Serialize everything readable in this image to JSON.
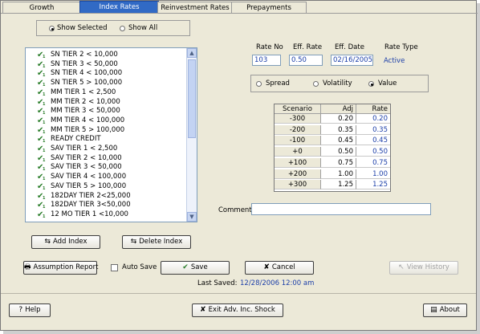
{
  "tabs": [
    {
      "label": "Growth"
    },
    {
      "label": "Index Rates"
    },
    {
      "label": "Reinvestment Rates"
    },
    {
      "label": "Prepayments"
    }
  ],
  "show_filter": {
    "selected": "Show Selected",
    "all": "Show All"
  },
  "index_list": [
    "SN TIER 2 < 10,000",
    "SN TIER 3 < 50,000",
    "SN TIER 4 < 100,000",
    "SN TIER 5 > 100,000",
    "MM TIER 1 < 2,500",
    "MM TIER 2 < 10,000",
    "MM TIER 3 < 50,000",
    "MM TIER 4 < 100,000",
    "MM TIER 5 > 100,000",
    "READY CREDIT",
    "SAV TIER 1 < 2,500",
    "SAV TIER 2 < 10,000",
    "SAV TIER 3 < 50,000",
    "SAV TIER 4 < 100,000",
    "SAV TIER 5 > 100,000",
    "182DAY TIER 2<25,000",
    "182DAY TIER 3<50,000",
    "12 MO TIER 1 <10,000"
  ],
  "rate_header": {
    "rate_no": "Rate No",
    "eff_rate": "Eff. Rate",
    "eff_date": "Eff. Date",
    "rate_type": "Rate Type"
  },
  "rate_values": {
    "rate_no": "103",
    "eff_rate": "0.50",
    "eff_date": "02/16/2005",
    "rate_type": "Active"
  },
  "mode": {
    "spread": "Spread",
    "volatility": "Volatility",
    "value": "Value",
    "selected": "Value"
  },
  "scenario_table": {
    "headers": [
      "Scenario",
      "Adj",
      "Rate"
    ],
    "rows": [
      {
        "scenario": "-300",
        "adj": "0.20",
        "rate": "0.20"
      },
      {
        "scenario": "-200",
        "adj": "0.35",
        "rate": "0.35"
      },
      {
        "scenario": "-100",
        "adj": "0.45",
        "rate": "0.45"
      },
      {
        "scenario": "+0",
        "adj": "0.50",
        "rate": "0.50"
      },
      {
        "scenario": "+100",
        "adj": "0.75",
        "rate": "0.75"
      },
      {
        "scenario": "+200",
        "adj": "1.00",
        "rate": "1.00"
      },
      {
        "scenario": "+300",
        "adj": "1.25",
        "rate": "1.25"
      }
    ]
  },
  "comment": {
    "label": "Comment:",
    "value": ""
  },
  "buttons": {
    "add_index": "Add Index",
    "delete_index": "Delete Index",
    "assumption_report": "Assumption Report",
    "auto_save": "Auto Save",
    "save": "Save",
    "cancel": "Cancel",
    "view_history": "View History",
    "help": "Help",
    "exit": "Exit Adv. Inc. Shock",
    "about": "About"
  },
  "last_saved": {
    "label": "Last Saved:",
    "value": "12/28/2006 12:00 am"
  },
  "colors": {
    "tab_active": "#316ac5",
    "value_blue": "#1b3ea8",
    "check_green": "#2a7d2a"
  }
}
